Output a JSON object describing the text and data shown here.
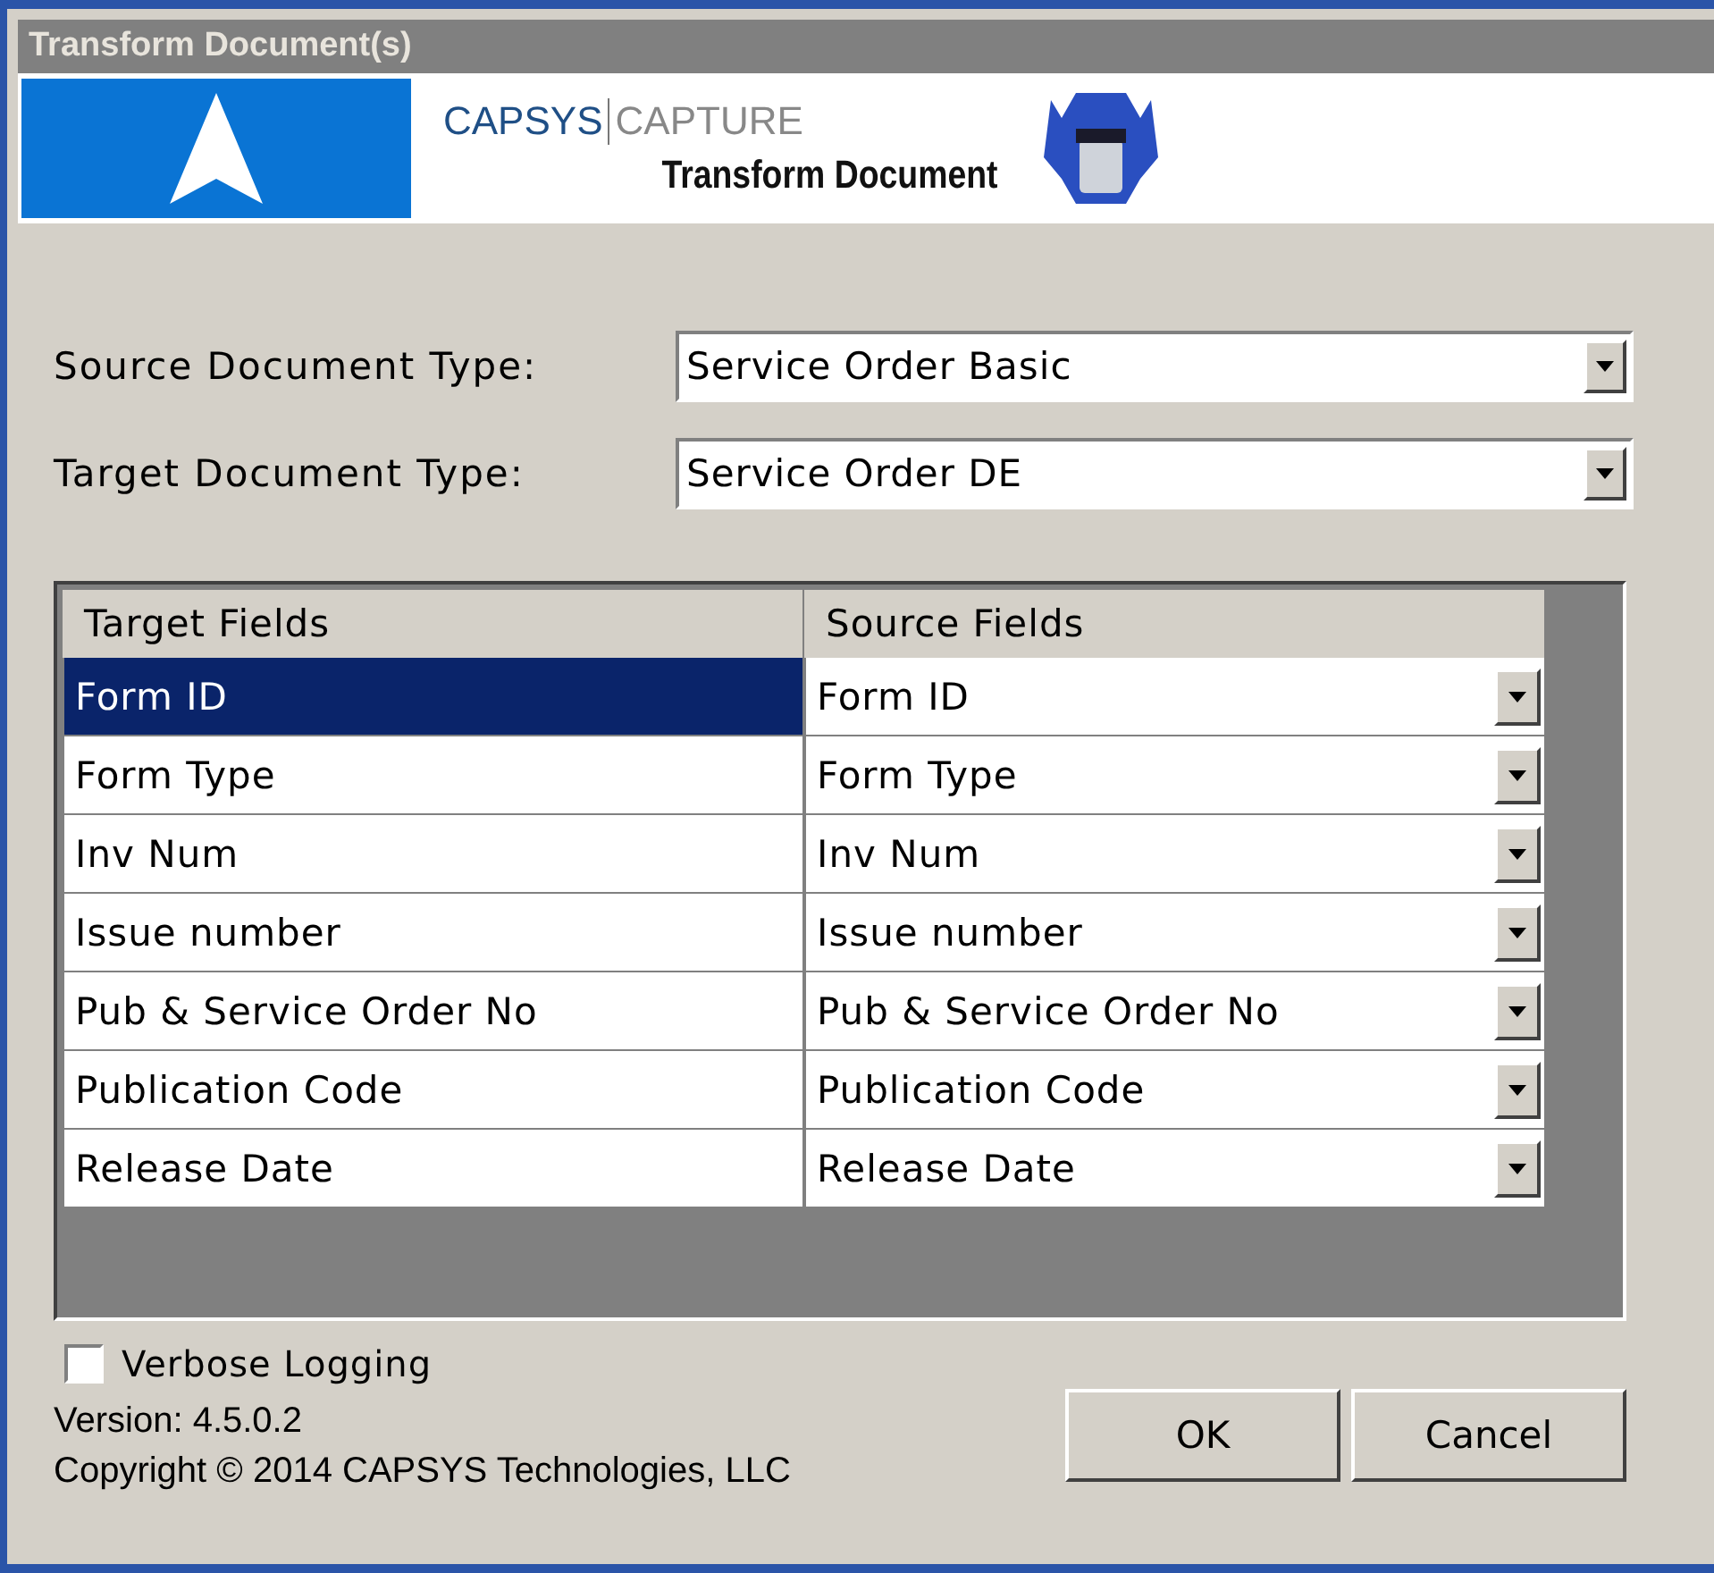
{
  "window": {
    "title": "Transform Document(s)"
  },
  "banner": {
    "brand": "CAPSYS",
    "product": "CAPTURE",
    "subtitle": "Transform Document"
  },
  "source_document_type": {
    "label": "Source Document Type:",
    "value": "Service Order Basic"
  },
  "target_document_type": {
    "label": "Target Document Type:",
    "value": "Service Order DE"
  },
  "grid": {
    "columns": [
      "Target Fields",
      "Source Fields"
    ],
    "rows": [
      {
        "target": "Form ID",
        "source": "Form ID",
        "selected": true
      },
      {
        "target": "Form Type",
        "source": "Form Type",
        "selected": false
      },
      {
        "target": "Inv Num",
        "source": "Inv Num",
        "selected": false
      },
      {
        "target": "Issue number",
        "source": "Issue number",
        "selected": false
      },
      {
        "target": "Pub & Service Order No",
        "source": "Pub & Service Order No",
        "selected": false
      },
      {
        "target": "Publication Code",
        "source": "Publication Code",
        "selected": false
      },
      {
        "target": "Release Date",
        "source": "Release Date",
        "selected": false
      }
    ]
  },
  "verbose_logging": {
    "label": "Verbose Logging",
    "checked": false
  },
  "version": "Version:  4.5.0.2",
  "copyright": "Copyright © 2014  CAPSYS Technologies, LLC",
  "buttons": [
    "OK",
    "Cancel"
  ]
}
